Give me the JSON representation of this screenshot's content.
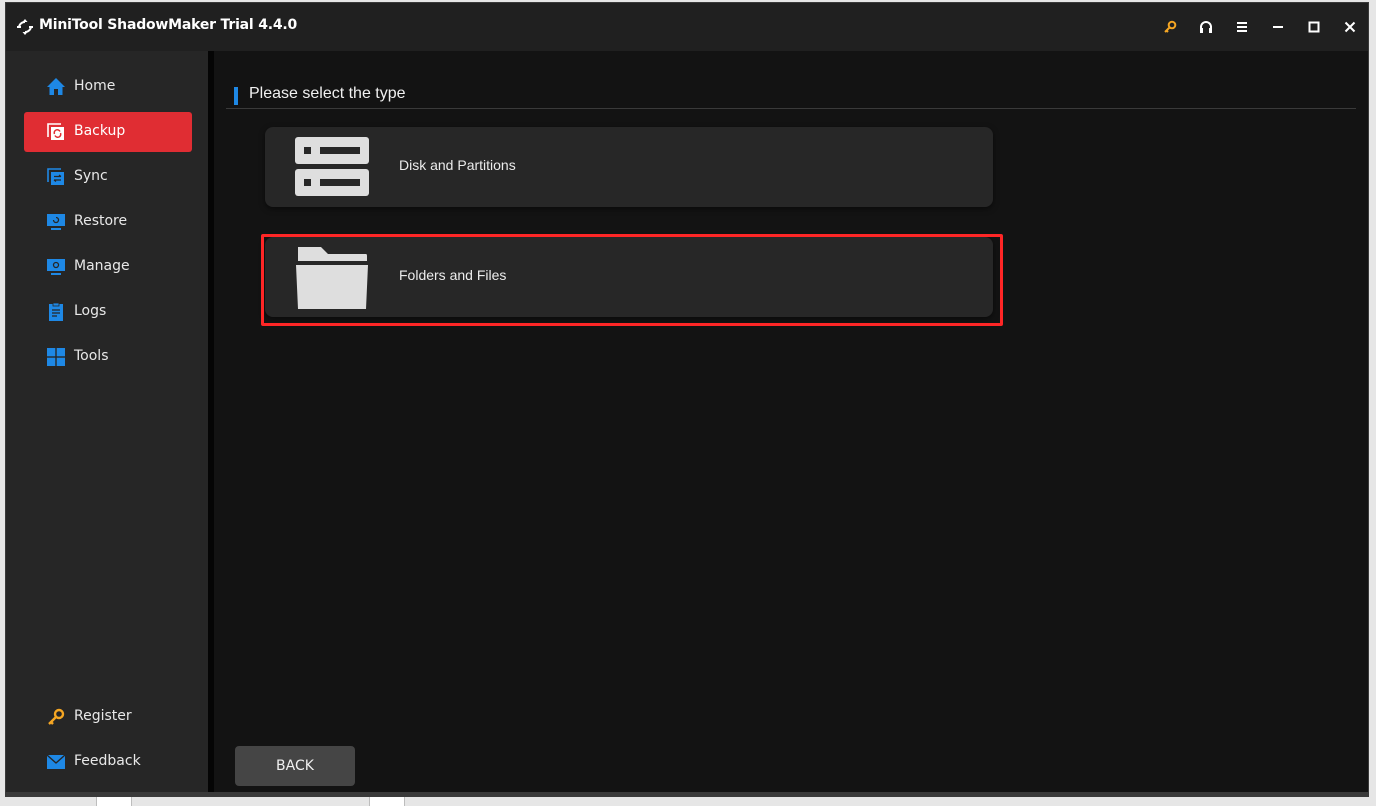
{
  "window": {
    "title": "MiniTool ShadowMaker Trial 4.4.0",
    "titlebar_icons": [
      "key-icon",
      "headset-icon",
      "menu-icon",
      "minimize-icon",
      "maximize-icon",
      "close-icon"
    ]
  },
  "sidebar": {
    "items": [
      {
        "label": "Home",
        "icon": "home-icon",
        "active": false
      },
      {
        "label": "Backup",
        "icon": "backup-icon",
        "active": true
      },
      {
        "label": "Sync",
        "icon": "sync-icon",
        "active": false
      },
      {
        "label": "Restore",
        "icon": "restore-icon",
        "active": false
      },
      {
        "label": "Manage",
        "icon": "manage-icon",
        "active": false
      },
      {
        "label": "Logs",
        "icon": "logs-icon",
        "active": false
      },
      {
        "label": "Tools",
        "icon": "tools-icon",
        "active": false
      }
    ],
    "bottom_items": [
      {
        "label": "Register",
        "icon": "key-icon"
      },
      {
        "label": "Feedback",
        "icon": "mail-icon"
      }
    ]
  },
  "main": {
    "section_title": "Please select the type",
    "options": [
      {
        "label": "Disk and Partitions",
        "icon": "disk-icon",
        "highlighted": false
      },
      {
        "label": "Folders and Files",
        "icon": "folder-icon",
        "highlighted": true
      }
    ],
    "back_label": "BACK"
  },
  "colors": {
    "accent_blue": "#1e88e5",
    "active_red": "#e02d33",
    "highlight_red": "#ff2626",
    "key_orange": "#f5a623"
  }
}
